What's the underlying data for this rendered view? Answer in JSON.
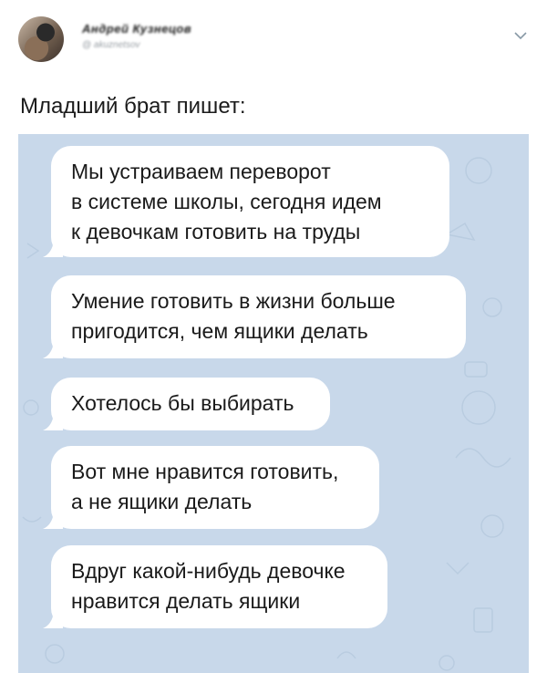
{
  "author": {
    "name": "Андрей Кузнецов",
    "handle": "@ akuznetsov"
  },
  "tweet": {
    "text": "Младший брат пишет:"
  },
  "messages": [
    {
      "lines": [
        "Мы устраиваем переворот",
        "в системе школы, сегодня идем",
        "к девочкам готовить на труды"
      ]
    },
    {
      "lines": [
        "Умение готовить в жизни больше",
        "пригодится, чем ящики делать"
      ]
    },
    {
      "lines": [
        "Хотелось бы выбирать"
      ]
    },
    {
      "lines": [
        "Вот мне нравится готовить,",
        "а не ящики делать"
      ]
    },
    {
      "lines": [
        "Вдруг какой-нибудь девочке",
        "нравится делать ящики"
      ]
    }
  ],
  "icons": {
    "menu": "chevron-down-icon",
    "avatar": "avatar"
  },
  "colors": {
    "chat_background": "#c8d8ea",
    "bubble": "#ffffff"
  }
}
